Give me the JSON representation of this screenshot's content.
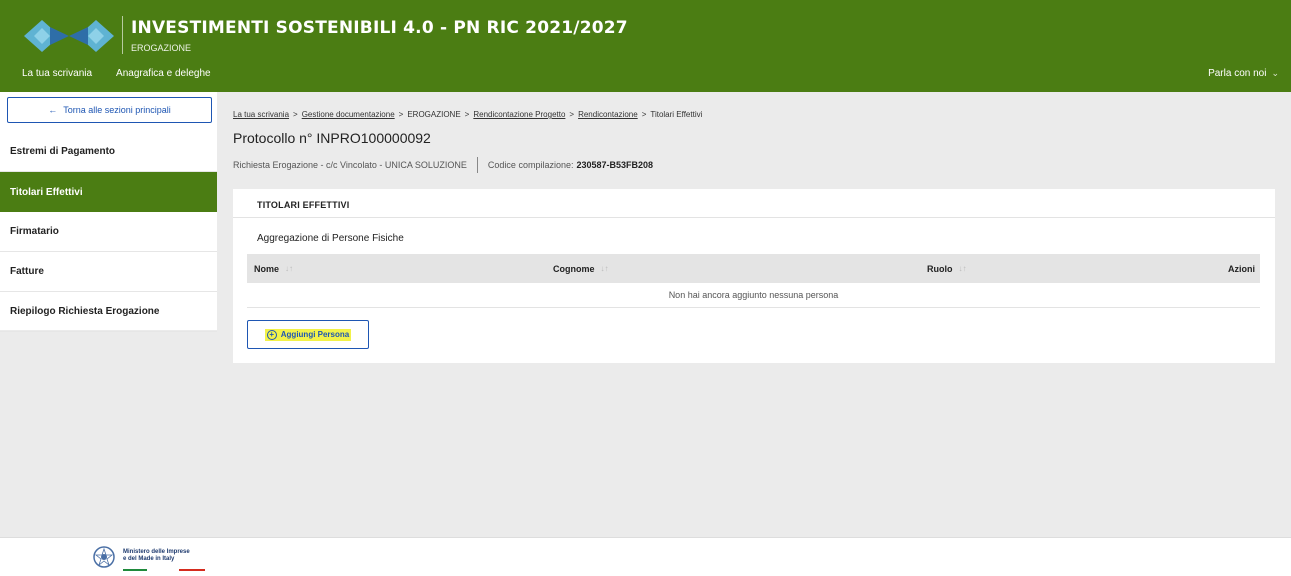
{
  "header": {
    "title": "INVESTIMENTI SOSTENIBILI 4.0 - PN RIC 2021/2027",
    "subtitle": "EROGAZIONE",
    "nav": [
      "La tua scrivania",
      "Anagrafica e deleghe"
    ],
    "chat_label": "Parla con noi"
  },
  "sidebar": {
    "back_label": "Torna alle sezioni principali",
    "items": [
      {
        "label": "Estremi di Pagamento",
        "active": false
      },
      {
        "label": "Titolari Effettivi",
        "active": true
      },
      {
        "label": "Firmatario",
        "active": false
      },
      {
        "label": "Fatture",
        "active": false
      },
      {
        "label": "Riepilogo Richiesta Erogazione",
        "active": false
      }
    ]
  },
  "breadcrumb": [
    {
      "label": "La tua scrivania",
      "link": true
    },
    {
      "label": "Gestione documentazione",
      "link": true
    },
    {
      "label": "EROGAZIONE",
      "link": false
    },
    {
      "label": "Rendicontazione Progetto",
      "link": true
    },
    {
      "label": "Rendicontazione",
      "link": true
    },
    {
      "label": "Titolari Effettivi",
      "link": false
    }
  ],
  "protocol": "Protocollo n° INPRO100000092",
  "info": {
    "request": "Richiesta Erogazione - c/c Vincolato  -  UNICA SOLUZIONE",
    "code_label": "Codice compilazione:",
    "code_value": "230587-B53FB208"
  },
  "card": {
    "title": "TITOLARI EFFETTIVI",
    "section": "Aggregazione di Persone Fisiche",
    "columns": [
      "Nome",
      "Cognome",
      "Ruolo",
      "Azioni"
    ],
    "empty_message": "Non hai ancora aggiunto nessuna persona",
    "add_label": "Aggiungi Persona"
  },
  "footer": {
    "ministry_line1": "Ministero delle Imprese",
    "ministry_line2": "e del Made in Italy"
  },
  "colors": {
    "brand_green": "#4b7d13",
    "link_blue": "#1e56b3",
    "highlight_yellow": "#f2f24a"
  }
}
